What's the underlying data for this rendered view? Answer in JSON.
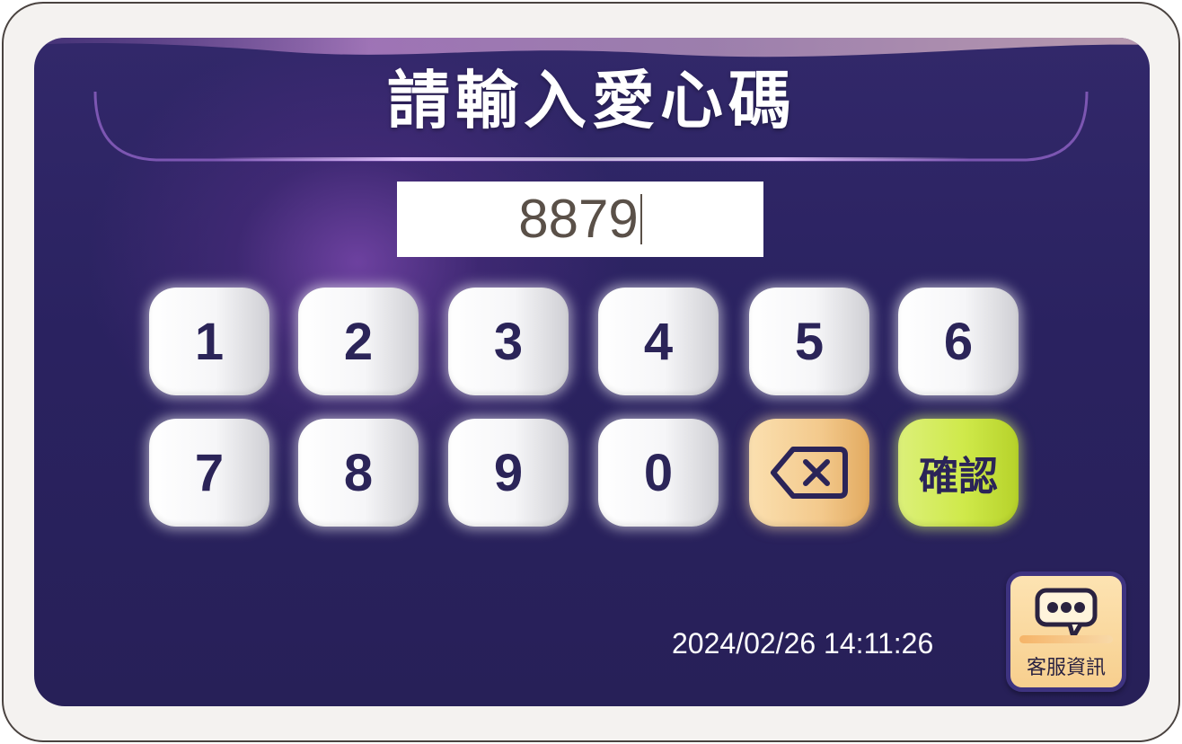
{
  "title": "請輸入愛心碼",
  "code_input": {
    "value": "8879"
  },
  "keypad": {
    "keys": [
      "1",
      "2",
      "3",
      "4",
      "5",
      "6",
      "7",
      "8",
      "9",
      "0"
    ],
    "backspace_icon": "backspace-icon",
    "confirm_label": "確認"
  },
  "status": {
    "datetime": "2024/02/26 14:11:26"
  },
  "customer_service": {
    "label": "客服資訊",
    "icon": "chat-bubble-icon"
  },
  "colors": {
    "screen_bg": "#2a2260",
    "key_text": "#2b2458",
    "backspace_key": "#f3c98c",
    "confirm_key": "#cfe94a",
    "service_button": "#f7cf8e"
  }
}
